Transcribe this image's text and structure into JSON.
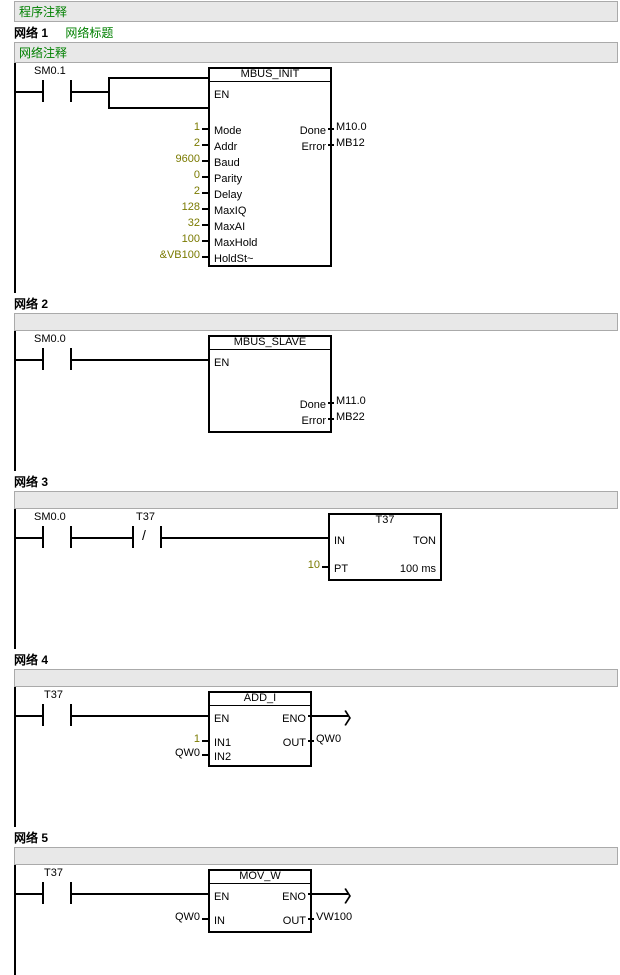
{
  "header": {
    "program_comment": "程序注释"
  },
  "networks": [
    {
      "id": 1,
      "label": "网络 1",
      "title": "网络标题",
      "comment": "网络注释",
      "contact": "SM0.1",
      "block": {
        "name": "MBUS_INIT",
        "inputs": [
          {
            "pin": "EN",
            "val": ""
          },
          {
            "pin": "Mode",
            "val": "1"
          },
          {
            "pin": "Addr",
            "val": "2"
          },
          {
            "pin": "Baud",
            "val": "9600"
          },
          {
            "pin": "Parity",
            "val": "0"
          },
          {
            "pin": "Delay",
            "val": "2"
          },
          {
            "pin": "MaxIQ",
            "val": "128"
          },
          {
            "pin": "MaxAI",
            "val": "32"
          },
          {
            "pin": "MaxHold",
            "val": "100"
          },
          {
            "pin": "HoldSt~",
            "val": "&VB100"
          }
        ],
        "outputs": [
          {
            "pin": "Done",
            "val": "M10.0"
          },
          {
            "pin": "Error",
            "val": "MB12"
          }
        ]
      }
    },
    {
      "id": 2,
      "label": "网络 2",
      "contact": "SM0.0",
      "block": {
        "name": "MBUS_SLAVE",
        "inputs": [
          {
            "pin": "EN",
            "val": ""
          }
        ],
        "outputs": [
          {
            "pin": "Done",
            "val": "M11.0"
          },
          {
            "pin": "Error",
            "val": "MB22"
          }
        ]
      }
    },
    {
      "id": 3,
      "label": "网络 3",
      "contact1": "SM0.0",
      "contact2": "T37",
      "contact2_nc": true,
      "block": {
        "name": "T37",
        "type": "TON",
        "inputs": [
          {
            "pin": "IN",
            "val": ""
          },
          {
            "pin": "PT",
            "val": "10"
          }
        ],
        "timebase": "100 ms"
      }
    },
    {
      "id": 4,
      "label": "网络 4",
      "contact": "T37",
      "block": {
        "name": "ADD_I",
        "inputs": [
          {
            "pin": "EN",
            "val": ""
          },
          {
            "pin": "IN1",
            "val": "1"
          },
          {
            "pin": "IN2",
            "val": "QW0"
          }
        ],
        "outputs": [
          {
            "pin": "ENO",
            "val": ""
          },
          {
            "pin": "OUT",
            "val": "QW0"
          }
        ]
      }
    },
    {
      "id": 5,
      "label": "网络 5",
      "contact": "T37",
      "block": {
        "name": "MOV_W",
        "inputs": [
          {
            "pin": "EN",
            "val": ""
          },
          {
            "pin": "IN",
            "val": "QW0"
          }
        ],
        "outputs": [
          {
            "pin": "ENO",
            "val": ""
          },
          {
            "pin": "OUT",
            "val": "VW100"
          }
        ]
      }
    }
  ],
  "chart_data": {
    "type": "table",
    "description": "S7-200 ladder diagram networks",
    "networks": [
      {
        "n": 1,
        "contacts": [
          "SM0.1"
        ],
        "block": "MBUS_INIT",
        "in": {
          "Mode": 1,
          "Addr": 2,
          "Baud": 9600,
          "Parity": 0,
          "Delay": 2,
          "MaxIQ": 128,
          "MaxAI": 32,
          "MaxHold": 100,
          "HoldStart": "&VB100"
        },
        "out": {
          "Done": "M10.0",
          "Error": "MB12"
        }
      },
      {
        "n": 2,
        "contacts": [
          "SM0.0"
        ],
        "block": "MBUS_SLAVE",
        "out": {
          "Done": "M11.0",
          "Error": "MB22"
        }
      },
      {
        "n": 3,
        "contacts": [
          "SM0.0",
          "/T37"
        ],
        "block": "TON T37",
        "in": {
          "PT": 10
        },
        "timebase": "100 ms"
      },
      {
        "n": 4,
        "contacts": [
          "T37"
        ],
        "block": "ADD_I",
        "in": {
          "IN1": 1,
          "IN2": "QW0"
        },
        "out": {
          "OUT": "QW0"
        }
      },
      {
        "n": 5,
        "contacts": [
          "T37"
        ],
        "block": "MOV_W",
        "in": {
          "IN": "QW0"
        },
        "out": {
          "OUT": "VW100"
        }
      }
    ]
  }
}
